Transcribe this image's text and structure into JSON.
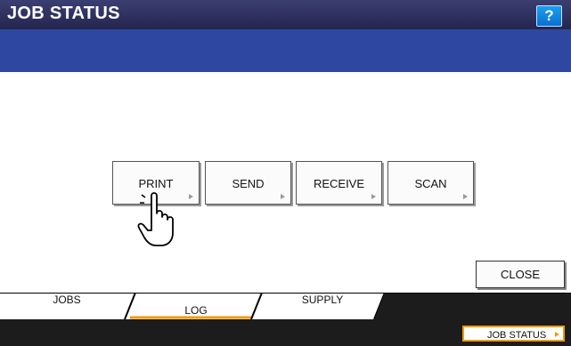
{
  "window": {
    "title": "JOB STATUS",
    "help_label": "?"
  },
  "log_buttons": [
    {
      "label": "PRINT"
    },
    {
      "label": "SEND"
    },
    {
      "label": "RECEIVE"
    },
    {
      "label": "SCAN"
    }
  ],
  "close_label": "CLOSE",
  "tabs": [
    {
      "label": "JOBS",
      "selected": false
    },
    {
      "label": "LOG",
      "selected": true
    },
    {
      "label": "SUPPLY",
      "selected": false
    }
  ],
  "footer": {
    "job_status_label": "JOB STATUS"
  },
  "colors": {
    "title_bar": "#2b2e5e",
    "band": "#2e48a2",
    "accent": "#f39a00",
    "help": "#1488e0"
  }
}
